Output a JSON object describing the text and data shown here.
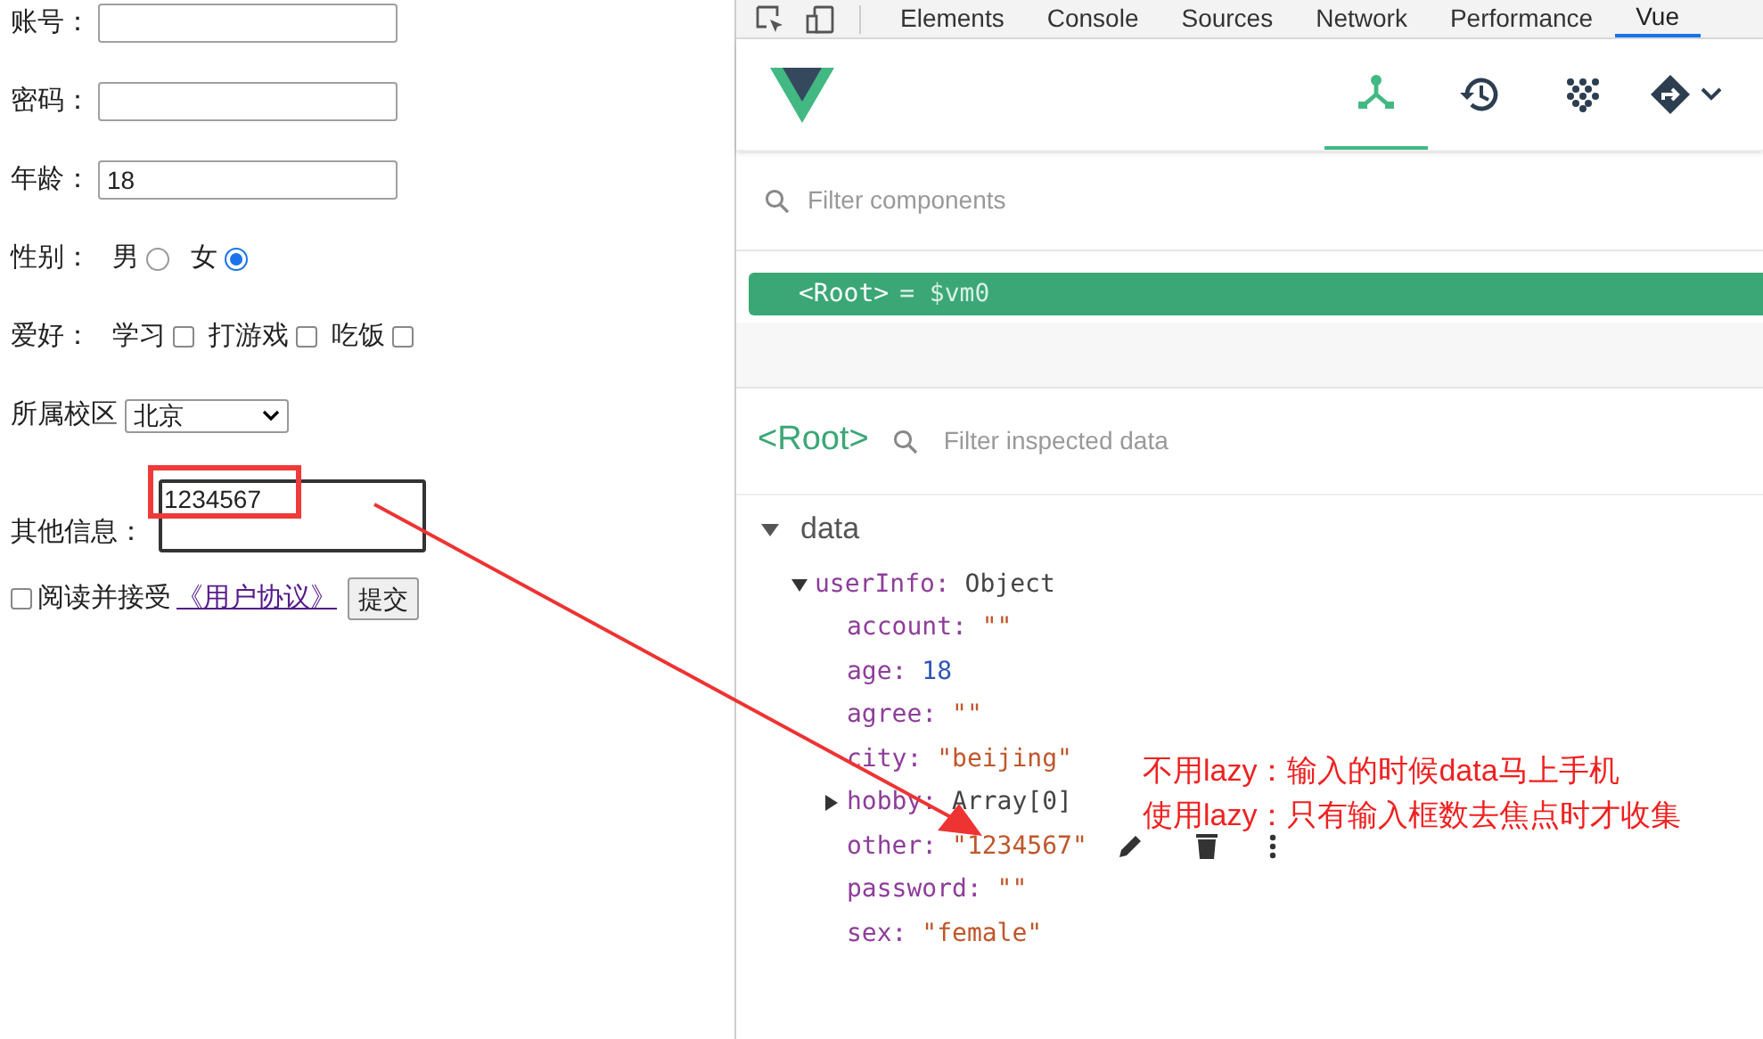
{
  "form": {
    "rows": [
      {
        "kind": "text",
        "label": "账号：",
        "value": ""
      },
      {
        "kind": "text",
        "label": "密码：",
        "value": ""
      },
      {
        "kind": "text",
        "label": "年龄：",
        "value": "18"
      },
      {
        "kind": "radio",
        "label": "性别：",
        "options": [
          {
            "label": "男",
            "selected": false
          },
          {
            "label": "女",
            "selected": true
          }
        ]
      },
      {
        "kind": "checkbox",
        "label": "爱好：",
        "options": [
          {
            "label": "学习",
            "checked": false
          },
          {
            "label": "打游戏",
            "checked": false
          },
          {
            "label": "吃饭",
            "checked": false
          }
        ]
      },
      {
        "kind": "select",
        "label": "所属校区",
        "value": "北京"
      },
      {
        "kind": "textarea",
        "label": "其他信息：",
        "value": "1234567"
      }
    ],
    "agree": {
      "checked": false,
      "text": "阅读并接受",
      "link": "《用户协议》"
    },
    "submit": "提交"
  },
  "devtools": {
    "tabs": [
      {
        "label": "Elements",
        "selected": false
      },
      {
        "label": "Console",
        "selected": false
      },
      {
        "label": "Sources",
        "selected": false
      },
      {
        "label": "Network",
        "selected": false
      },
      {
        "label": "Performance",
        "selected": false
      },
      {
        "label": "Vue",
        "selected": true
      }
    ],
    "vue_tabs": [
      {
        "selected": true
      },
      {
        "selected": false
      },
      {
        "selected": false
      },
      {
        "selected": false
      }
    ],
    "filter_components": {
      "placeholder": "Filter components"
    },
    "root_row": {
      "tag": "<Root>",
      "suffix": "= $vm0"
    },
    "inspector": {
      "title": "<Root>",
      "filter": {
        "placeholder": "Filter inspected data"
      },
      "section": "data",
      "tree": [
        {
          "key": "userInfo:",
          "value": "Object",
          "kind": "object",
          "expanded": true,
          "children": [
            {
              "key": "account:",
              "value": "\"\"",
              "kind": "string"
            },
            {
              "key": "age:",
              "value": "18",
              "kind": "number"
            },
            {
              "key": "agree:",
              "value": "\"\"",
              "kind": "string"
            },
            {
              "key": "city:",
              "value": "\"beijing\"",
              "kind": "string"
            },
            {
              "key": "hobby:",
              "value": "Array[0]",
              "kind": "object",
              "expanded": false
            },
            {
              "key": "other:",
              "value": "\"1234567\"",
              "kind": "string",
              "hovered": true
            },
            {
              "key": "password:",
              "value": "\"\"",
              "kind": "string"
            },
            {
              "key": "sex:",
              "value": "\"female\"",
              "kind": "string"
            }
          ]
        }
      ]
    }
  },
  "annotation": {
    "lines": [
      "不用lazy：输入的时候data马上手机",
      "使用lazy：只有输入框数去焦点时才收集"
    ]
  }
}
